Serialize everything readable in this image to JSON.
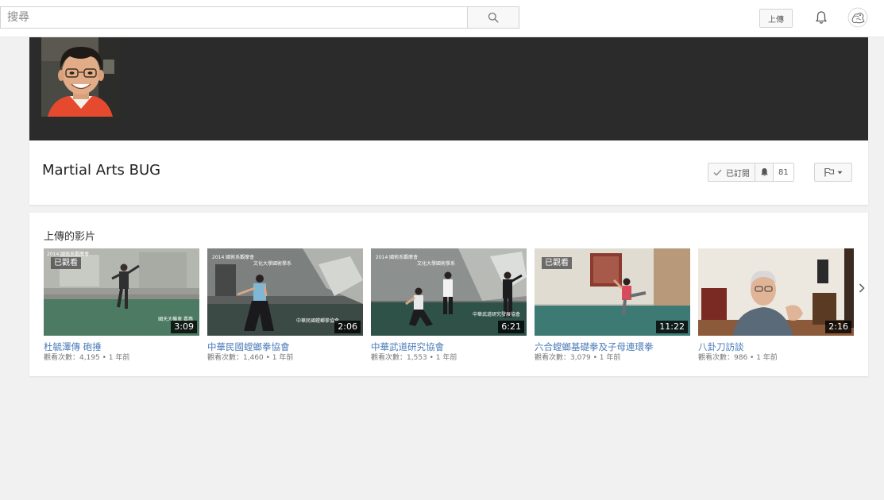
{
  "header": {
    "search_placeholder": "搜尋",
    "upload_label": "上傳"
  },
  "icons": {
    "search": "search-icon",
    "notifications": "bell-icon",
    "account": "account-avatar",
    "checkmark": "check-icon",
    "subscription_bell": "bell-icon",
    "flag": "flag-icon",
    "next": "chevron-right-icon"
  },
  "channel": {
    "title": "Martial Arts BUG",
    "subscribed_label": "已訂閱",
    "subscriber_count": "81"
  },
  "uploads": {
    "section_title": "上傳的影片",
    "videos": [
      {
        "title": "杜毓澤傳 砲捶",
        "meta": "觀看次數：4,195 • 1 年前",
        "duration": "3:09",
        "watched": "已觀看",
        "thumb_top_text": "2014 國術系觀摩會",
        "thumb_bottom_text": "國天大機車 嘉燕"
      },
      {
        "title": "中華民國螳螂拳協會",
        "meta": "觀看次數：1,460 • 1 年前",
        "duration": "2:06",
        "thumb_top_text": "2014 國術系觀摩會",
        "thumb_sub_text": "文化大學國術學系",
        "thumb_bottom_text": "中華民國螳螂拳協會"
      },
      {
        "title": "中華武道研究協會",
        "meta": "觀看次數：1,553 • 1 年前",
        "duration": "6:21",
        "thumb_top_text": "2014 國術系觀摩會",
        "thumb_sub_text": "文化大學國術學系",
        "thumb_bottom_text": "中華武道研究發展協會"
      },
      {
        "title": "六合螳螂基礎拳及子母連環拳",
        "meta": "觀看次數：3,079 • 1 年前",
        "duration": "11:22",
        "watched": "已觀看"
      },
      {
        "title": "八卦刀訪談",
        "meta": "觀看次數：986 • 1 年前",
        "duration": "2:16"
      }
    ]
  },
  "colors": {
    "banner": "#2b2b2b",
    "link": "#4a7ab8",
    "page_background": "#f1f1f1"
  }
}
